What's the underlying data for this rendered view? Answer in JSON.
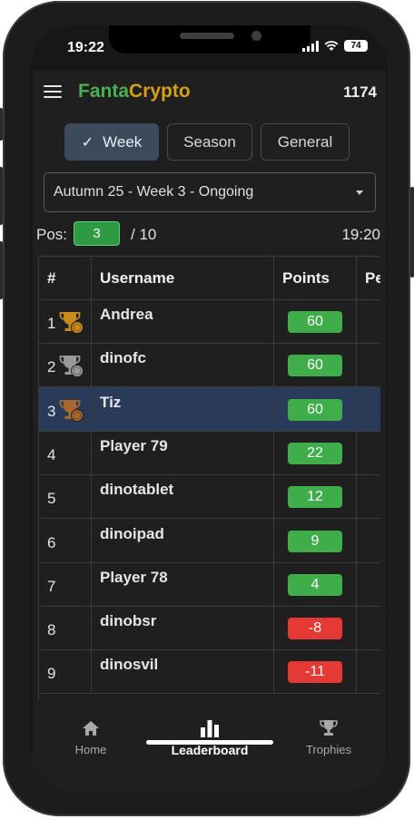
{
  "status_bar": {
    "time": "19:22",
    "battery": "74"
  },
  "app": {
    "brand_part1": "Fanta",
    "brand_part2": "Crypto",
    "balance": "1174"
  },
  "tabs": [
    {
      "label": "Week",
      "active": true
    },
    {
      "label": "Season",
      "active": false
    },
    {
      "label": "General",
      "active": false
    }
  ],
  "period_select": {
    "value": "Autumn 25 - Week 3 - Ongoing"
  },
  "position": {
    "label": "Pos:",
    "value": "3",
    "total": "/ 10",
    "time": "19:20"
  },
  "table": {
    "headers": [
      "#",
      "Username",
      "Points",
      "Pe"
    ],
    "rows": [
      {
        "rank": "1",
        "trophy": "gold",
        "username": "Andrea",
        "points": "60",
        "positive": true
      },
      {
        "rank": "2",
        "trophy": "silver",
        "username": "dinofc",
        "points": "60",
        "positive": true
      },
      {
        "rank": "3",
        "trophy": "bronze",
        "username": "Tiz",
        "points": "60",
        "positive": true,
        "highlight": true
      },
      {
        "rank": "4",
        "trophy": "",
        "username": "Player 79",
        "points": "22",
        "positive": true
      },
      {
        "rank": "5",
        "trophy": "",
        "username": "dinotablet",
        "points": "12",
        "positive": true
      },
      {
        "rank": "6",
        "trophy": "",
        "username": "dinoipad",
        "points": "9",
        "positive": true
      },
      {
        "rank": "7",
        "trophy": "",
        "username": "Player 78",
        "points": "4",
        "positive": true
      },
      {
        "rank": "8",
        "trophy": "",
        "username": "dinobsr",
        "points": "-8",
        "positive": false
      },
      {
        "rank": "9",
        "trophy": "",
        "username": "dinosvil",
        "points": "-11",
        "positive": false
      }
    ]
  },
  "bottom_nav": [
    {
      "label": "Home",
      "icon": "home-icon",
      "active": false
    },
    {
      "label": "Leaderboard",
      "icon": "leaderboard-icon",
      "active": true
    },
    {
      "label": "Trophies",
      "icon": "trophy-icon",
      "active": false
    }
  ],
  "colors": {
    "positive": "#3fae4a",
    "negative": "#e53935",
    "highlight": "#2a3b59",
    "gold": "#c98a1b",
    "silver": "#9a9a9a",
    "bronze": "#a8692e"
  }
}
